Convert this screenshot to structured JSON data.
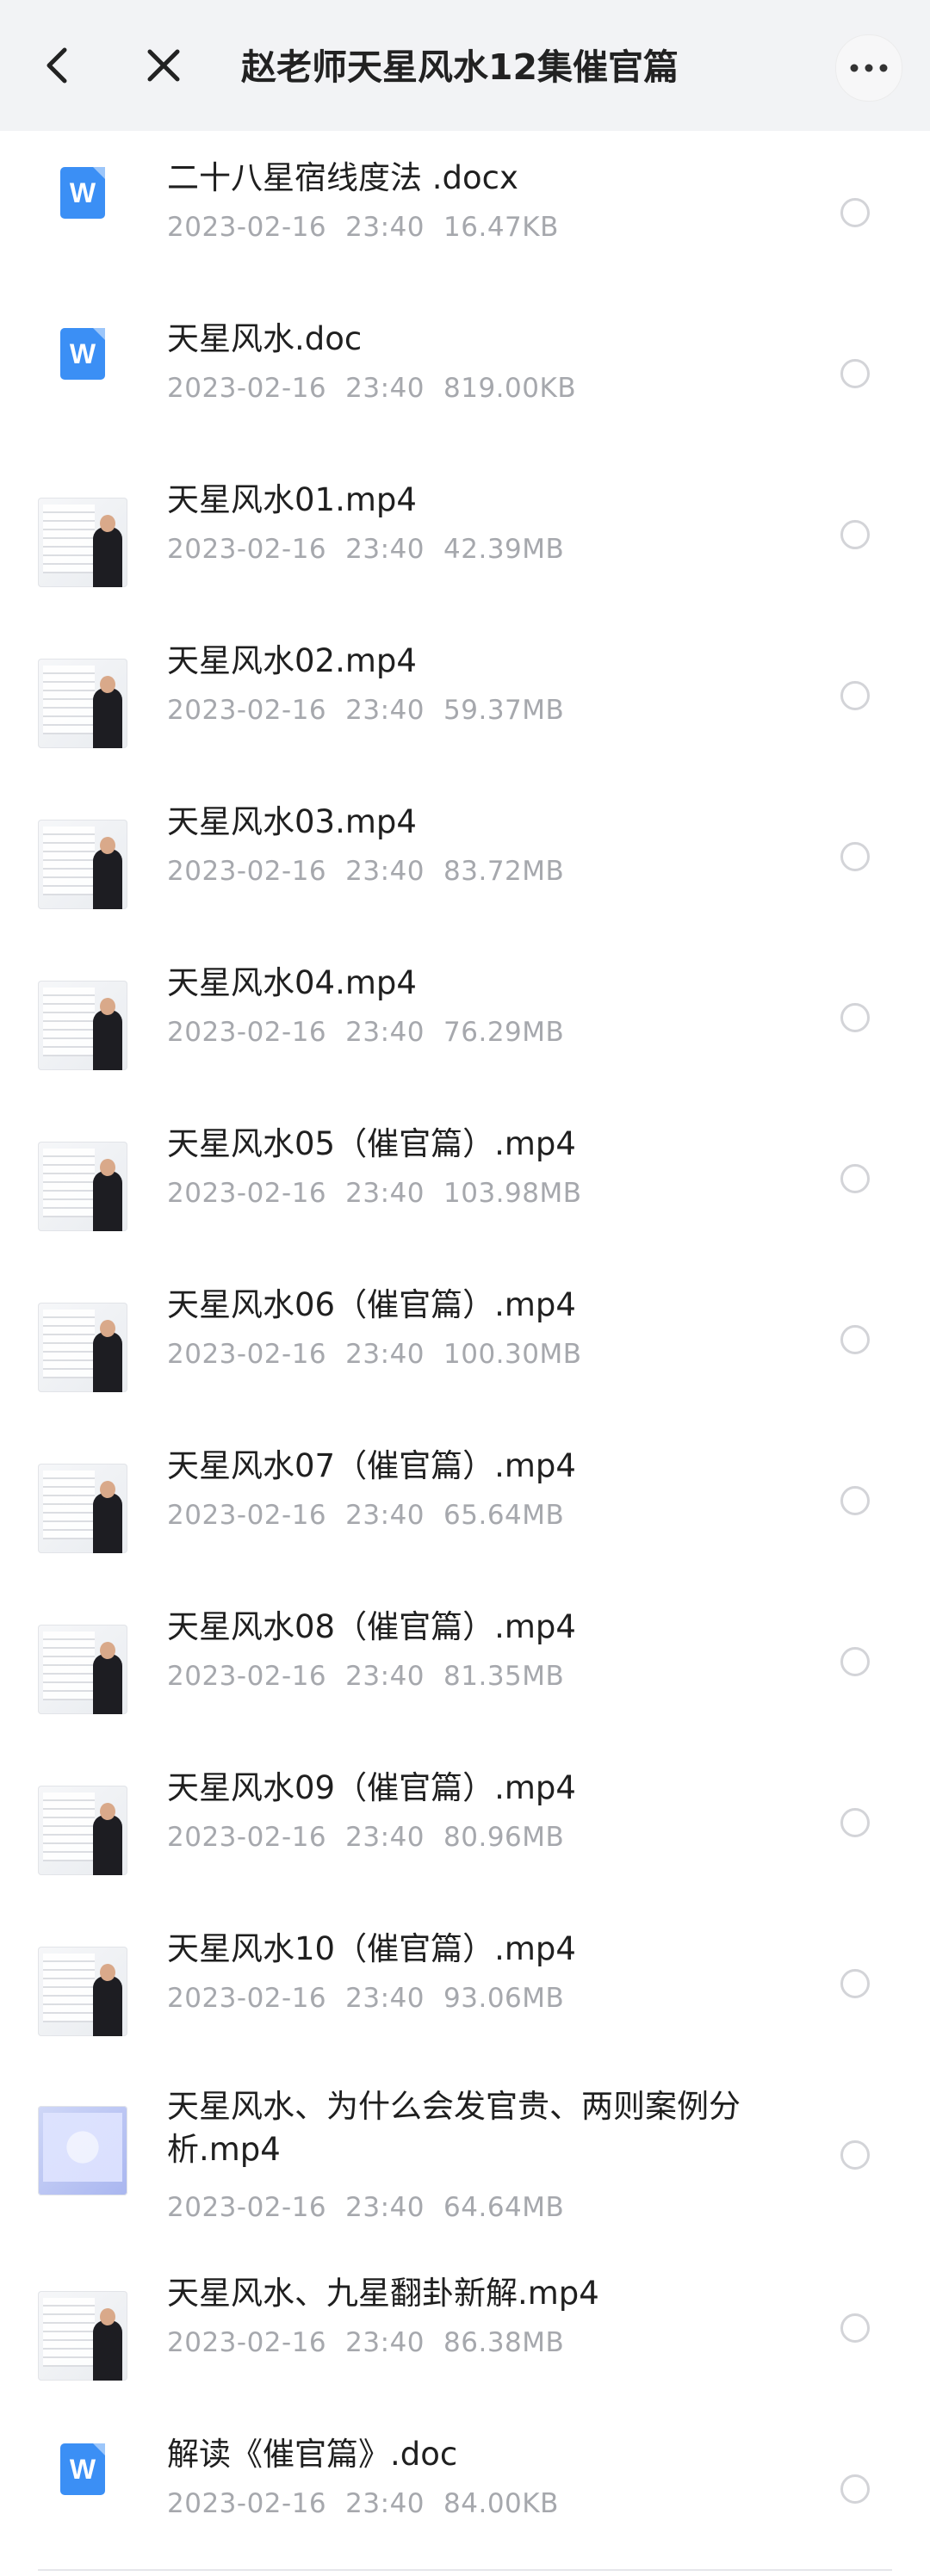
{
  "header": {
    "title": "赵老师天星风水12集催官篇"
  },
  "files": [
    {
      "name": "二十八星宿线度法 .docx",
      "date": "2023-02-16",
      "time": "23:40",
      "size": "16.47KB",
      "type": "doc"
    },
    {
      "name": "天星风水.doc",
      "date": "2023-02-16",
      "time": "23:40",
      "size": "819.00KB",
      "type": "doc"
    },
    {
      "name": "天星风水01.mp4",
      "date": "2023-02-16",
      "time": "23:40",
      "size": "42.39MB",
      "type": "video"
    },
    {
      "name": "天星风水02.mp4",
      "date": "2023-02-16",
      "time": "23:40",
      "size": "59.37MB",
      "type": "video"
    },
    {
      "name": "天星风水03.mp4",
      "date": "2023-02-16",
      "time": "23:40",
      "size": "83.72MB",
      "type": "video"
    },
    {
      "name": "天星风水04.mp4",
      "date": "2023-02-16",
      "time": "23:40",
      "size": "76.29MB",
      "type": "video"
    },
    {
      "name": "天星风水05（催官篇）.mp4",
      "date": "2023-02-16",
      "time": "23:40",
      "size": "103.98MB",
      "type": "video"
    },
    {
      "name": "天星风水06（催官篇）.mp4",
      "date": "2023-02-16",
      "time": "23:40",
      "size": "100.30MB",
      "type": "video"
    },
    {
      "name": "天星风水07（催官篇）.mp4",
      "date": "2023-02-16",
      "time": "23:40",
      "size": "65.64MB",
      "type": "video"
    },
    {
      "name": "天星风水08（催官篇）.mp4",
      "date": "2023-02-16",
      "time": "23:40",
      "size": "81.35MB",
      "type": "video"
    },
    {
      "name": "天星风水09（催官篇）.mp4",
      "date": "2023-02-16",
      "time": "23:40",
      "size": "80.96MB",
      "type": "video"
    },
    {
      "name": "天星风水10（催官篇）.mp4",
      "date": "2023-02-16",
      "time": "23:40",
      "size": "93.06MB",
      "type": "video"
    },
    {
      "name": "天星风水、为什么会发官贵、两则案例分析.mp4",
      "date": "2023-02-16",
      "time": "23:40",
      "size": "64.64MB",
      "type": "video-blue"
    },
    {
      "name": "天星风水、九星翻卦新解.mp4",
      "date": "2023-02-16",
      "time": "23:40",
      "size": "86.38MB",
      "type": "video"
    },
    {
      "name": "解读《催官篇》.doc",
      "date": "2023-02-16",
      "time": "23:40",
      "size": "84.00KB",
      "type": "doc"
    }
  ],
  "icons": {
    "back": "chevron-left-icon",
    "close": "close-icon",
    "more": "more-dots-icon",
    "doc": "word-doc-icon"
  },
  "colors": {
    "header_bg": "#f2f3f5",
    "doc_icon": "#3b8ff5",
    "meta_text": "#a6a8ad"
  }
}
